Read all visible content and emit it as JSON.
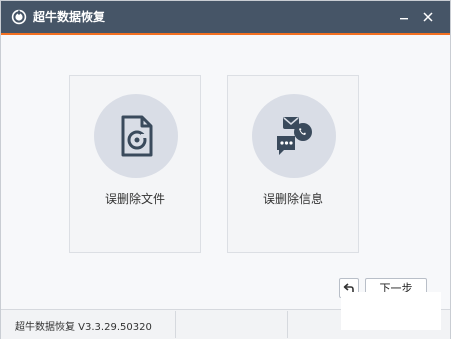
{
  "app": {
    "title": "超牛数据恢复",
    "icons": {
      "logo": "app-logo-icon",
      "minimize": "minimize-icon",
      "close": "close-icon"
    }
  },
  "colors": {
    "titlebar": "#465567",
    "accent": "#f37021",
    "icon_circle": "#d9dde6",
    "icon_fill": "#3a4a5c"
  },
  "options": [
    {
      "label": "误删除文件",
      "icon": "file-recovery-icon"
    },
    {
      "label": "误删除信息",
      "icon": "message-call-icon"
    }
  ],
  "nav": {
    "back_icon": "back-arrow-icon",
    "next_label": "下一步"
  },
  "status": {
    "version": "超牛数据恢复 V3.3.29.50320"
  }
}
